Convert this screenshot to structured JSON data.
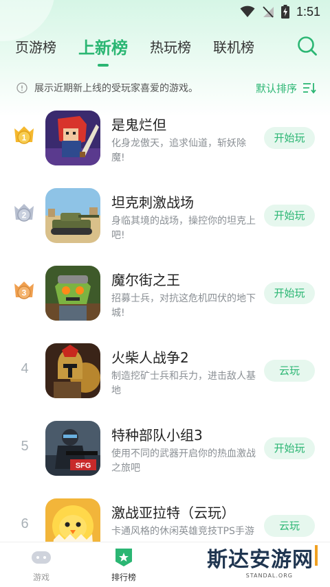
{
  "status_bar": {
    "time": "1:51"
  },
  "tabs": [
    {
      "label": "页游榜",
      "active": false
    },
    {
      "label": "上新榜",
      "active": true
    },
    {
      "label": "热玩榜",
      "active": false
    },
    {
      "label": "联机榜",
      "active": false
    }
  ],
  "info": {
    "text": "展示近期新上线的受玩家喜爱的游戏。",
    "sort_label": "默认排序"
  },
  "games": [
    {
      "rank": "1",
      "title": "是鬼烂但",
      "desc": "化身龙傲天，追求仙道，斩妖除魔!",
      "button": "开始玩"
    },
    {
      "rank": "2",
      "title": "坦克刺激战场",
      "desc": "身临其境的战场，操控你的坦克上吧!",
      "button": "开始玩"
    },
    {
      "rank": "3",
      "title": "魔尔街之王",
      "desc": "招募士兵，对抗这危机四伏的地下城!",
      "button": "开始玩"
    },
    {
      "rank": "4",
      "title": "火柴人战争2",
      "desc": "制造挖矿士兵和兵力，进击敌人基地",
      "button": "云玩"
    },
    {
      "rank": "5",
      "title": "特种部队小组3",
      "desc": "使用不同的武器开启你的热血激战之旅吧",
      "button": "开始玩"
    },
    {
      "rank": "6",
      "title": "激战亚拉特（云玩）",
      "desc": "卡通风格的休闲英雄竞技TPS手游",
      "button": "云玩"
    }
  ],
  "icon_badges": {
    "sfg": "SFG"
  },
  "bottom_nav": [
    {
      "label": "游戏",
      "active": false
    },
    {
      "label": "排行榜",
      "active": true
    }
  ],
  "watermark": {
    "text": "斯达安游网",
    "sub": "STANDAL.ORG"
  },
  "colors": {
    "accent": "#2bb673",
    "gold": "#f5b82e",
    "silver": "#b7bfd0",
    "bronze": "#f0a050"
  }
}
